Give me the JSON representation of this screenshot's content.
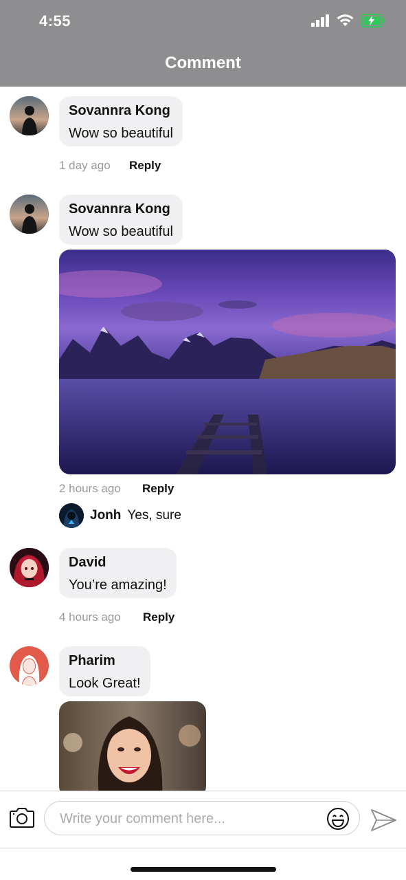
{
  "status_bar": {
    "time": "4:55"
  },
  "header": {
    "title": "Comment"
  },
  "comments": [
    {
      "name": "Sovannra Kong",
      "text": "Wow so beautiful",
      "time": "1 day ago",
      "reply_label": "Reply"
    },
    {
      "name": "Sovannra Kong",
      "text": "Wow so beautiful",
      "time": "2 hours ago",
      "reply_label": "Reply",
      "replies": [
        {
          "name": "Jonh",
          "text": "Yes, sure"
        }
      ]
    },
    {
      "name": "David",
      "text": "You’re amazing!",
      "time": "4 hours ago",
      "reply_label": "Reply"
    },
    {
      "name": "Pharim",
      "text": "Look Great!"
    }
  ],
  "composer": {
    "placeholder": "Write your comment here...",
    "camera_icon": "camera-icon",
    "emoji_icon": "emoji-icon",
    "send_icon": "send-icon"
  },
  "colors": {
    "header_bg": "#8e8e91",
    "bubble_bg": "#f0f0f3",
    "battery": "#34c759"
  }
}
